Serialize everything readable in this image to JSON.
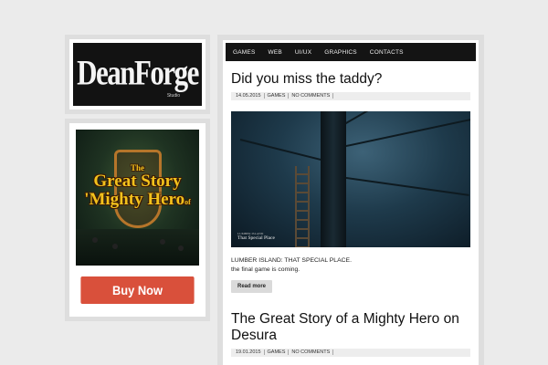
{
  "sidebar": {
    "logo_text": "DeanForge",
    "logo_sub": "Studio",
    "promo": {
      "title_line1": "The",
      "title_line2": "Great Story",
      "title_of": "of",
      "title_line3": "'Mighty Hero"
    },
    "buy_label": "Buy Now"
  },
  "nav": {
    "items": [
      "GAMES",
      "WEB",
      "UI/UX",
      "GRAPHICS",
      "CONTACTS"
    ]
  },
  "posts": [
    {
      "title": "Did you miss the taddy?",
      "date": "14.05.2015",
      "category": "GAMES",
      "comments": "NO COMMENTS",
      "image_caption_small": "LUMBER ISLAND",
      "image_caption": "That Special Place",
      "excerpt_line1": "LUMBER ISLAND: THAT SPECIAL PLACE.",
      "excerpt_line2": "the final game is coming.",
      "read_more": "Read more"
    },
    {
      "title": "The Great Story of a Mighty Hero on Desura",
      "date": "19.01.2015",
      "category": "GAMES",
      "comments": "NO COMMENTS"
    }
  ],
  "colors": {
    "background": "#ebebeb",
    "nav_bg": "#141414",
    "buy_button": "#d9503b",
    "promo_title": "#f3c21c"
  }
}
